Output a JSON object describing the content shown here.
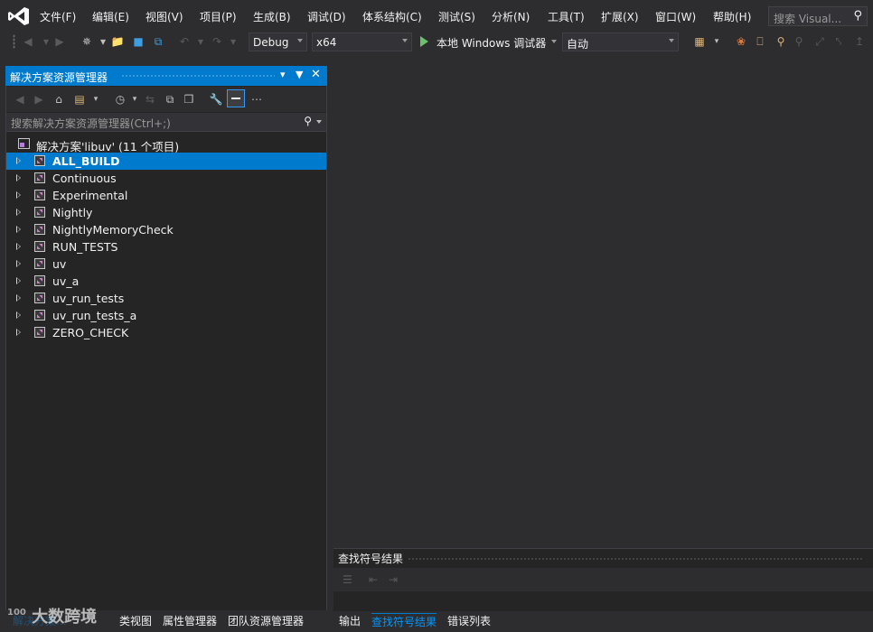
{
  "menu": {
    "items": [
      "文件(F)",
      "编辑(E)",
      "视图(V)",
      "项目(P)",
      "生成(B)",
      "调试(D)",
      "体系结构(C)",
      "测试(S)",
      "分析(N)",
      "工具(T)",
      "扩展(X)",
      "窗口(W)",
      "帮助(H)"
    ],
    "search_placeholder": "搜索 Visual..."
  },
  "toolbar": {
    "config": "Debug",
    "platform": "x64",
    "run_label": "本地 Windows 调试器",
    "mode": "自动"
  },
  "solution_explorer": {
    "title": "解决方案资源管理器",
    "search_placeholder": "搜索解决方案资源管理器(Ctrl+;)",
    "solution_label": "解决方案'libuv' (11 个项目)",
    "projects": [
      "ALL_BUILD",
      "Continuous",
      "Experimental",
      "Nightly",
      "NightlyMemoryCheck",
      "RUN_TESTS",
      "uv",
      "uv_a",
      "uv_run_tests",
      "uv_run_tests_a",
      "ZERO_CHECK"
    ],
    "selected": "ALL_BUILD",
    "bottom_tabs": [
      "解决方案...",
      "类视图",
      "属性管理器",
      "团队资源管理器"
    ]
  },
  "find_symbol": {
    "title": "查找符号结果"
  },
  "output_tabs": [
    "输出",
    "查找符号结果",
    "错误列表"
  ],
  "watermark": {
    "prefix": "100",
    "text": "大数跨境"
  },
  "colors": {
    "accent": "#007acc",
    "background": "#2d2d30",
    "panel": "#252526",
    "text": "#f1f1f1",
    "active_tab": "#0097fb"
  }
}
